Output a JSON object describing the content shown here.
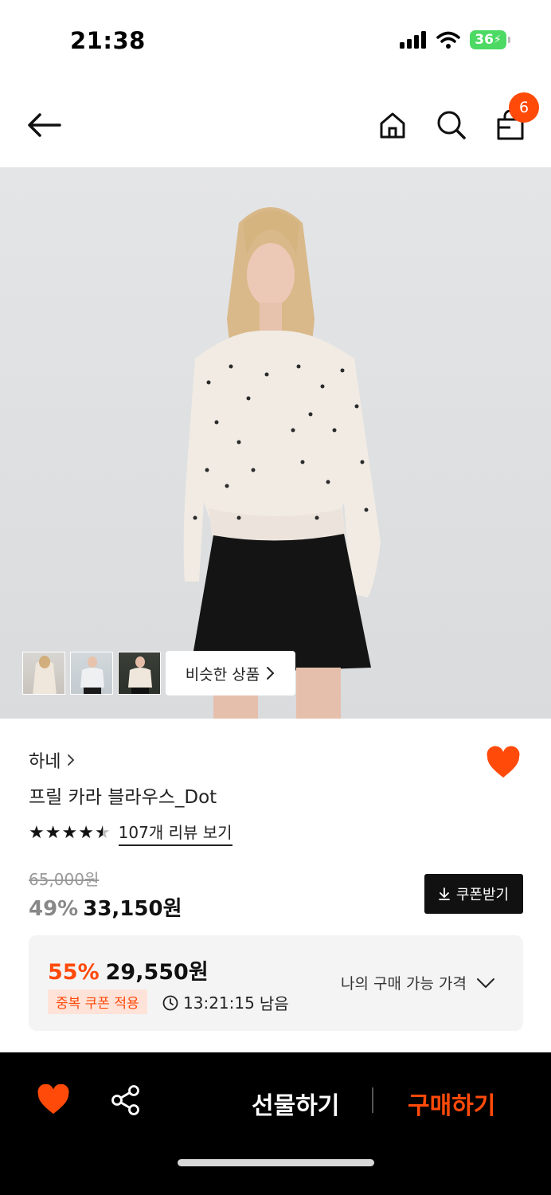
{
  "status_bar": {
    "time": "21:38",
    "battery": "36"
  },
  "nav": {
    "back_icon": "arrow-left-icon",
    "home_icon": "home-icon",
    "search_icon": "search-icon",
    "cart_icon": "shopping-bag-icon",
    "cart_count": "6"
  },
  "gallery": {
    "similar_label": "비슷한 상품",
    "thumbnail_count": 3
  },
  "product": {
    "brand": "하네",
    "name": "프릴 카라 블라우스_Dot",
    "rating": 4.5,
    "review_label": "107개 리뷰 보기",
    "original_price": "65,000원",
    "discount_pct": "49%",
    "sale_price": "33,150원",
    "coupon_label": "쿠폰받기"
  },
  "best_price": {
    "discount_pct": "55%",
    "price": "29,550원",
    "coupon_badge": "중복 쿠폰 적용",
    "timer": "13:21:15",
    "timer_suffix": "남음",
    "available_label": "나의 구매 가능 가격"
  },
  "bottom_bar": {
    "gift_label": "선물하기",
    "buy_label": "구매하기"
  },
  "colors": {
    "accent": "#ff4a0a",
    "badge_bg": "#ffe3d9",
    "bottom_bar": "#000000"
  }
}
